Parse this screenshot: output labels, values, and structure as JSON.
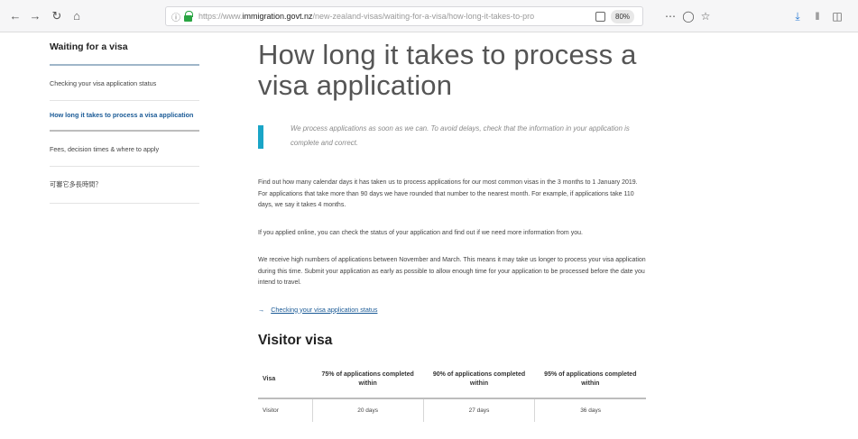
{
  "browser": {
    "url_prefix": "https://www.",
    "url_domain": "immigration.govt.nz",
    "url_path": "/new-zealand-visas/waiting-for-a-visa/how-long-it-takes-to-pro",
    "zoom": "80%",
    "icons": {
      "back": "arrow-left-icon",
      "forward": "arrow-right-icon",
      "reload": "reload-icon",
      "home": "home-icon",
      "info": "info-icon",
      "lock": "lock-icon",
      "reader": "reader-view-icon",
      "more": "more-icon",
      "pocket": "pocket-icon",
      "bookmark": "star-icon",
      "downloads": "download-icon",
      "library": "library-icon",
      "sidebar": "sidebar-icon"
    },
    "accent_color": "#2aa543"
  },
  "sidebar": {
    "title": "Waiting for a visa",
    "items": [
      {
        "label": "Checking your visa application status"
      },
      {
        "label": "How long it takes to process a visa application"
      },
      {
        "label": "Fees, decision times & where to apply"
      },
      {
        "label": "可審它多長時間？"
      }
    ],
    "active_color": "#1a5a96"
  },
  "main": {
    "title": "How long it takes to process a visa application",
    "callout": "We process applications as soon as we can. To avoid delays, check that the information in your application is complete and correct.",
    "callout_color": "#1aa5c7",
    "paragraphs": [
      "Find out how many calendar days it has taken us to process applications for our most common visas in the 3 months to 1 January 2019. For applications that take more than 90 days we have rounded that number to the nearest month. For example, if applications take 110 days, we say it takes 4 months.",
      "If you applied online, you can check the status of your application and find out if we need more information from you.",
      "We receive high numbers of applications between November and March. This means it may take us longer to process your visa application during this time. Submit your application as early as possible to allow enough time for your application to be processed before the date you intend to travel."
    ],
    "link": "Checking your visa application status",
    "section_title": "Visitor visa",
    "table": {
      "headers": [
        "Visa",
        "75% of applications completed within",
        "90% of applications completed within",
        "95% of applications completed within"
      ],
      "rows": [
        [
          "Visitor",
          "20 days",
          "27 days",
          "36 days"
        ]
      ]
    }
  }
}
